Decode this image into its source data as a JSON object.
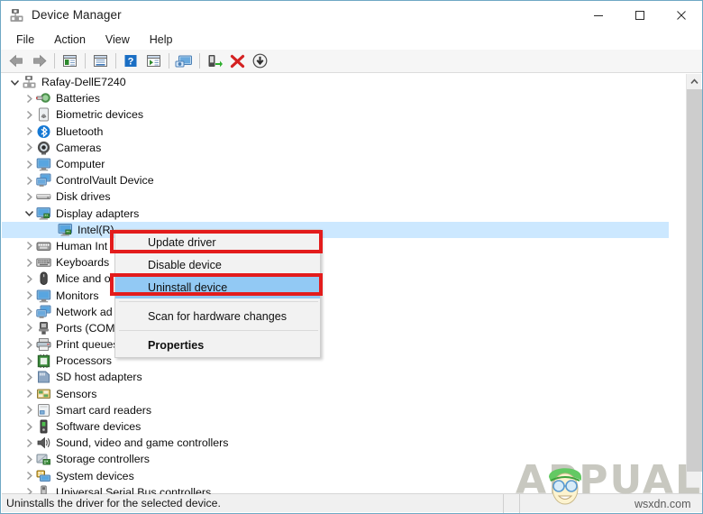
{
  "window": {
    "title": "Device Manager",
    "icon": "device-manager-icon",
    "border_color": "#6fa8c4",
    "controls": {
      "minimize": "minimize-icon",
      "maximize": "maximize-icon",
      "close": "close-icon"
    }
  },
  "menubar": {
    "items": [
      {
        "label": "File"
      },
      {
        "label": "Action"
      },
      {
        "label": "View"
      },
      {
        "label": "Help"
      }
    ]
  },
  "toolbar": {
    "buttons": [
      {
        "name": "back-icon",
        "tip": "Back"
      },
      {
        "name": "forward-icon",
        "tip": "Forward"
      },
      {
        "name": "separator",
        "tip": ""
      },
      {
        "name": "show-hide-console-tree-icon",
        "tip": "Show/Hide Console Tree"
      },
      {
        "name": "separator",
        "tip": ""
      },
      {
        "name": "properties-icon",
        "tip": "Properties"
      },
      {
        "name": "separator",
        "tip": ""
      },
      {
        "name": "help-icon",
        "tip": "Help"
      },
      {
        "name": "view-icon",
        "tip": "View"
      },
      {
        "name": "separator",
        "tip": ""
      },
      {
        "name": "scan-for-hardware-changes-icon",
        "tip": "Scan for hardware changes"
      },
      {
        "name": "separator",
        "tip": ""
      },
      {
        "name": "update-driver-icon",
        "tip": "Update driver"
      },
      {
        "name": "uninstall-device-icon",
        "tip": "Uninstall device"
      },
      {
        "name": "disable-device-icon",
        "tip": "Disable device"
      }
    ]
  },
  "tree": {
    "nodes": [
      {
        "label": "Rafay-DellE7240",
        "depth": 0,
        "expander": "expanded",
        "icon": "computer-root-icon",
        "selected": false
      },
      {
        "label": "Batteries",
        "depth": 1,
        "expander": "collapsed",
        "icon": "battery-icon",
        "selected": false
      },
      {
        "label": "Biometric devices",
        "depth": 1,
        "expander": "collapsed",
        "icon": "fingerprint-icon",
        "selected": false
      },
      {
        "label": "Bluetooth",
        "depth": 1,
        "expander": "collapsed",
        "icon": "bluetooth-icon",
        "selected": false
      },
      {
        "label": "Cameras",
        "depth": 1,
        "expander": "collapsed",
        "icon": "camera-icon",
        "selected": false
      },
      {
        "label": "Computer",
        "depth": 1,
        "expander": "collapsed",
        "icon": "monitor-icon",
        "selected": false
      },
      {
        "label": "ControlVault Device",
        "depth": 1,
        "expander": "collapsed",
        "icon": "network-monitor-icon",
        "selected": false
      },
      {
        "label": "Disk drives",
        "depth": 1,
        "expander": "collapsed",
        "icon": "disk-drive-icon",
        "selected": false
      },
      {
        "label": "Display adapters",
        "depth": 1,
        "expander": "expanded",
        "icon": "display-adapter-icon",
        "selected": false
      },
      {
        "label": "Intel(R)",
        "depth": 2,
        "expander": "none",
        "icon": "display-adapter-icon",
        "selected": true
      },
      {
        "label": "Human Int",
        "depth": 1,
        "expander": "collapsed",
        "icon": "hid-icon",
        "selected": false
      },
      {
        "label": "Keyboards",
        "depth": 1,
        "expander": "collapsed",
        "icon": "keyboard-icon",
        "selected": false
      },
      {
        "label": "Mice and o",
        "depth": 1,
        "expander": "collapsed",
        "icon": "mouse-icon",
        "selected": false
      },
      {
        "label": "Monitors",
        "depth": 1,
        "expander": "collapsed",
        "icon": "monitor-icon",
        "selected": false
      },
      {
        "label": "Network ad",
        "depth": 1,
        "expander": "collapsed",
        "icon": "network-monitor-icon",
        "selected": false
      },
      {
        "label": "Ports (COM",
        "depth": 1,
        "expander": "collapsed",
        "icon": "port-icon",
        "selected": false
      },
      {
        "label": "Print queues",
        "depth": 1,
        "expander": "collapsed",
        "icon": "printer-icon",
        "selected": false
      },
      {
        "label": "Processors",
        "depth": 1,
        "expander": "collapsed",
        "icon": "processor-icon",
        "selected": false
      },
      {
        "label": "SD host adapters",
        "depth": 1,
        "expander": "collapsed",
        "icon": "sd-host-icon",
        "selected": false
      },
      {
        "label": "Sensors",
        "depth": 1,
        "expander": "collapsed",
        "icon": "sensor-icon",
        "selected": false
      },
      {
        "label": "Smart card readers",
        "depth": 1,
        "expander": "collapsed",
        "icon": "smartcard-icon",
        "selected": false
      },
      {
        "label": "Software devices",
        "depth": 1,
        "expander": "collapsed",
        "icon": "software-device-icon",
        "selected": false
      },
      {
        "label": "Sound, video and game controllers",
        "depth": 1,
        "expander": "collapsed",
        "icon": "speaker-icon",
        "selected": false
      },
      {
        "label": "Storage controllers",
        "depth": 1,
        "expander": "collapsed",
        "icon": "storage-controller-icon",
        "selected": false
      },
      {
        "label": "System devices",
        "depth": 1,
        "expander": "collapsed",
        "icon": "system-device-icon",
        "selected": false
      },
      {
        "label": "Universal Serial Bus controllers",
        "depth": 1,
        "expander": "collapsed",
        "icon": "usb-icon",
        "selected": false
      }
    ]
  },
  "context_menu": {
    "items": [
      {
        "label": "Update driver",
        "highlighted": false,
        "bold": false
      },
      {
        "label": "Disable device",
        "highlighted": false,
        "bold": false
      },
      {
        "label": "Uninstall device",
        "highlighted": true,
        "bold": false
      },
      {
        "label": "Scan for hardware changes",
        "highlighted": false,
        "bold": false
      },
      {
        "label": "Properties",
        "highlighted": false,
        "bold": true
      }
    ],
    "highlight_color": "#92c9f4",
    "annotation_color": "#e31c1c"
  },
  "statusbar": {
    "text": "Uninstalls the driver for the selected device."
  },
  "scrollbar": {
    "up_arrow": "chevron-up-icon",
    "down_arrow": "chevron-down-icon"
  },
  "watermarks": {
    "brand": "APPUALS",
    "site": "wsxdn.com"
  }
}
